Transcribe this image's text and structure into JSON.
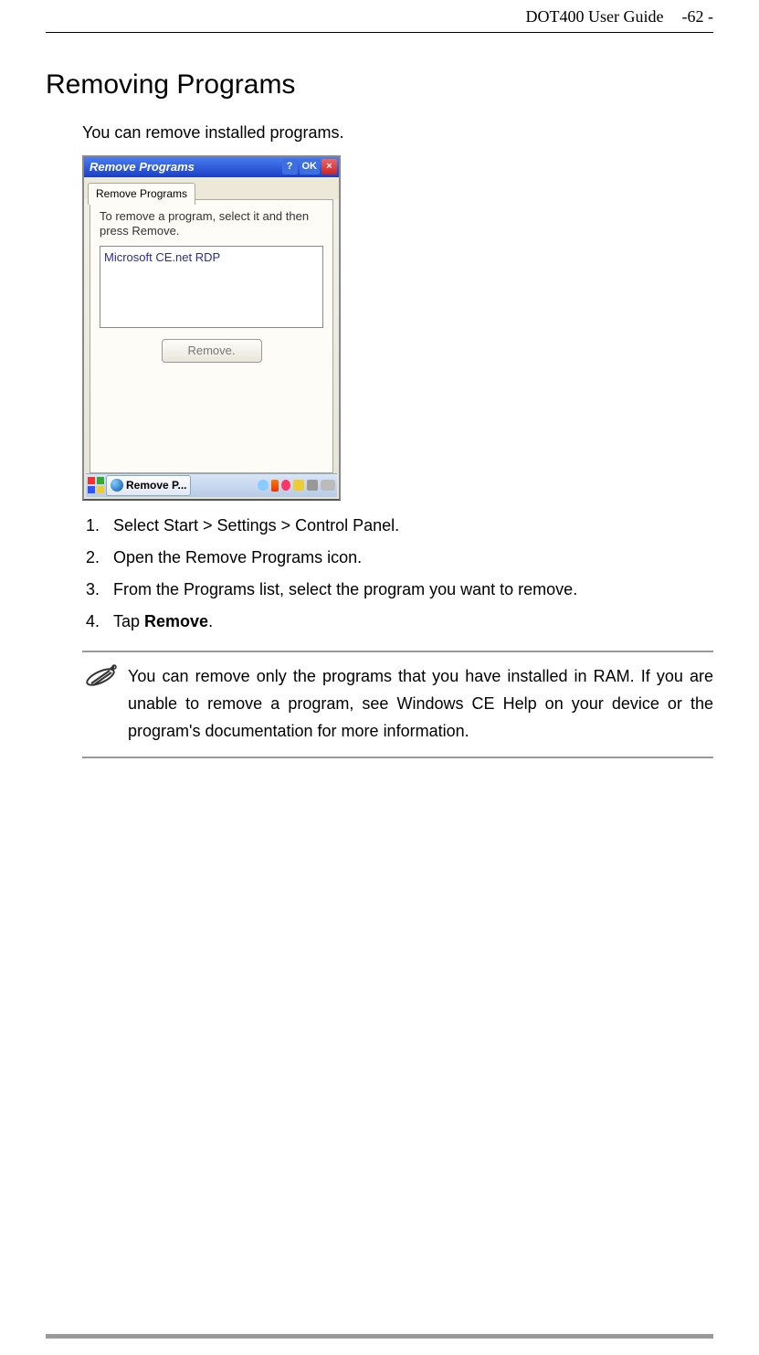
{
  "header": {
    "doc_title": "DOT400 User Guide",
    "page_number": "-62 -"
  },
  "section_title": "Removing Programs",
  "intro_text": "You can remove installed programs.",
  "screenshot": {
    "window_title": "Remove Programs",
    "help_label": "?",
    "ok_label": "OK",
    "close_label": "×",
    "tab_label": "Remove Programs",
    "instruction_text": "To remove a program, select it and then press Remove.",
    "list_item": "Microsoft CE.net RDP",
    "remove_button_label": "Remove.",
    "taskbar_task_label": "Remove P..."
  },
  "steps": {
    "s1": "Select Start > Settings > Control Panel.",
    "s2": "Open the Remove Programs icon.",
    "s3": "From the Programs list, select the program you want to remove.",
    "s4_pre": "Tap ",
    "s4_bold": "Remove",
    "s4_post": "."
  },
  "note_text": "You can remove only the programs that you have installed in RAM. If you are unable to remove a program, see Windows CE Help on your device or the program's documentation for more information."
}
